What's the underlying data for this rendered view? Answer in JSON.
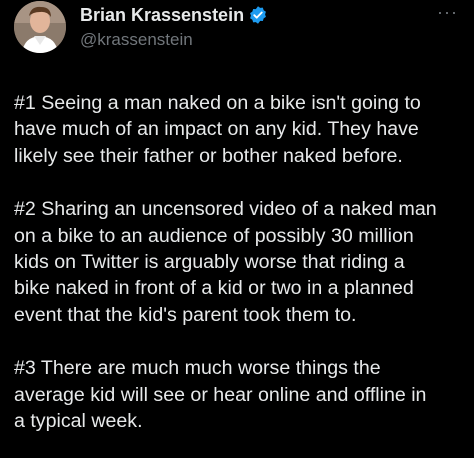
{
  "author": {
    "display_name": "Brian Krassenstein",
    "handle": "@krassenstein",
    "verified": true,
    "verified_color": "#1d9bf0"
  },
  "more_menu": {
    "label": "···",
    "icon": "more-horizontal-icon"
  },
  "tweet": {
    "paragraphs": [
      {
        "lines": [
          "#1 Seeing a man naked on a bike isn't going to",
          "have much of an impact on any kid.  They have",
          "likely see their father or bother naked before."
        ]
      },
      {
        "lines": [
          "#2 Sharing an uncensored video of a naked man",
          "on a bike to an audience of possibly 30 million",
          "kids on Twitter is arguably worse that riding a",
          "bike naked in front of a kid or two in a planned",
          "event that the kid's parent took them to."
        ]
      },
      {
        "lines": [
          "#3 There are much much worse things the",
          "average kid will see or hear online and offline in",
          "a typical week."
        ]
      }
    ]
  },
  "colors": {
    "background": "#000000",
    "text": "#e7e9ea",
    "secondary_text": "#71767b"
  }
}
